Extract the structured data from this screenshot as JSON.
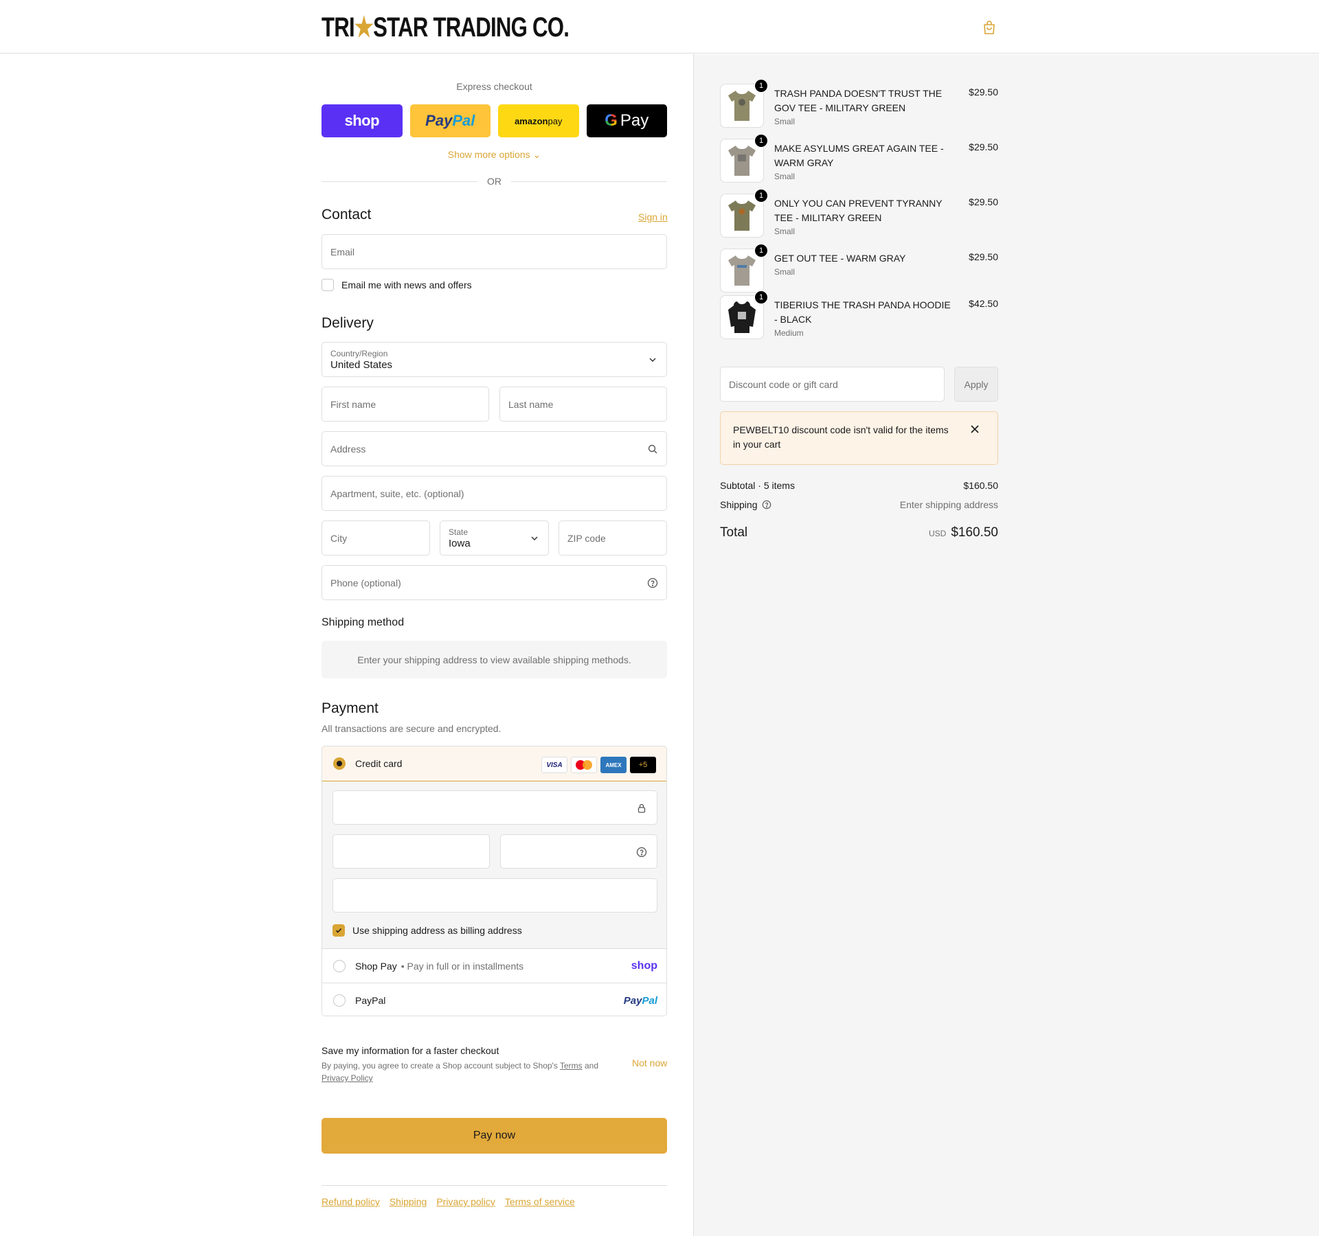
{
  "brand": {
    "logo_left": "TRI",
    "logo_star": "★",
    "logo_right": "STAR TRADING CO."
  },
  "express": {
    "title": "Express checkout",
    "shop_label": "shop",
    "paypal_label_a": "Pay",
    "paypal_label_b": "Pal",
    "amazon_label_a": "amazon",
    "amazon_label_b": " pay",
    "gpay_g": "G",
    "gpay_label": "Pay",
    "more_options": "Show more options ⌄",
    "or": "OR"
  },
  "contact": {
    "title": "Contact",
    "sign_in": "Sign in",
    "email_placeholder": "Email",
    "news_label": "Email me with news and offers"
  },
  "delivery": {
    "title": "Delivery",
    "country_label": "Country/Region",
    "country_value": "United States",
    "first_name": "First name",
    "last_name": "Last name",
    "address": "Address",
    "apartment": "Apartment, suite, etc. (optional)",
    "city": "City",
    "state_label": "State",
    "state_value": "Iowa",
    "zip": "ZIP code",
    "phone": "Phone (optional)"
  },
  "shipping_method": {
    "title": "Shipping method",
    "message": "Enter your shipping address to view available shipping methods."
  },
  "payment": {
    "title": "Payment",
    "subtitle": "All transactions are secure and encrypted.",
    "credit_card": "Credit card",
    "card_visa": "VISA",
    "card_amex": "AMEX",
    "card_more": "+5",
    "billing_label": "Use shipping address as billing address",
    "shop_pay": "Shop Pay",
    "shop_pay_sub": "• Pay in full or in installments",
    "shop_brand": "shop",
    "paypal": "PayPal",
    "paypal_brand_a": "Pay",
    "paypal_brand_b": "Pal"
  },
  "save_info": {
    "title": "Save my information for a faster checkout",
    "desc_a": "By paying, you agree to create a Shop account subject to Shop's ",
    "terms": "Terms",
    "desc_b": " and ",
    "privacy": "Privacy Policy",
    "not_now": "Not now"
  },
  "pay_now": "Pay now",
  "footer": {
    "links": [
      "Refund policy",
      "Shipping",
      "Privacy policy",
      "Terms of service"
    ]
  },
  "cart": {
    "items": [
      {
        "name": "TRASH PANDA DOESN'T TRUST THE GOV TEE - MILITARY GREEN",
        "variant": "Small",
        "price": "$29.50",
        "qty": "1",
        "color": "#8f8a68"
      },
      {
        "name": "MAKE ASYLUMS GREAT AGAIN TEE - WARM GRAY",
        "variant": "Small",
        "price": "$29.50",
        "qty": "1",
        "color": "#9b958a"
      },
      {
        "name": "ONLY YOU CAN PREVENT TYRANNY TEE - MILITARY GREEN",
        "variant": "Small",
        "price": "$29.50",
        "qty": "1",
        "color": "#7d7a58"
      },
      {
        "name": "GET OUT TEE - WARM GRAY",
        "variant": "Small",
        "price": "$29.50",
        "qty": "1",
        "color": "#a29c92"
      },
      {
        "name": "TIBERIUS THE TRASH PANDA HOODIE - BLACK",
        "variant": "Medium",
        "price": "$42.50",
        "qty": "1",
        "color": "#1c1c1c"
      }
    ],
    "discount_placeholder": "Discount code or gift card",
    "apply": "Apply",
    "alert": "PEWBELT10 discount code isn't valid for the items in your cart",
    "subtotal_label": "Subtotal · 5 items",
    "subtotal_value": "$160.50",
    "shipping_label": "Shipping",
    "shipping_value": "Enter shipping address",
    "total_label": "Total",
    "currency": "USD",
    "total_value": "$160.50"
  },
  "colors": {
    "accent": "#d9a534",
    "shop_purple": "#5a31f4",
    "paypal_yellow": "#ffc439",
    "amazon_yellow": "#ffd814"
  }
}
